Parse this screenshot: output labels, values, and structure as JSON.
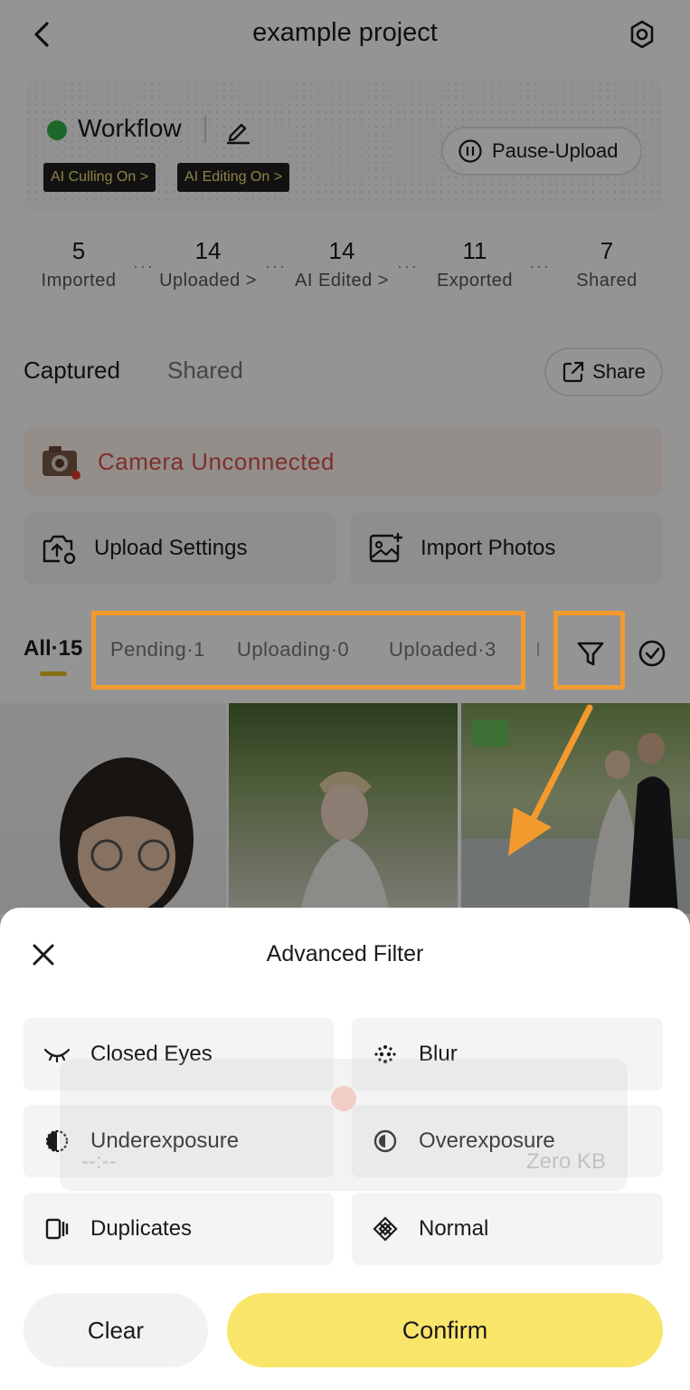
{
  "header": {
    "title": "example project"
  },
  "workflow": {
    "title": "Workflow",
    "badges": [
      "AI Culling On >",
      "AI Editing On >"
    ],
    "pause_label": "Pause-Upload",
    "stats": [
      {
        "value": "5",
        "label": "Imported"
      },
      {
        "value": "14",
        "label": "Uploaded >"
      },
      {
        "value": "14",
        "label": "AI Edited >"
      },
      {
        "value": "11",
        "label": "Exported"
      },
      {
        "value": "7",
        "label": "Shared"
      }
    ],
    "stat_separator": "···"
  },
  "tabs": {
    "captured": "Captured",
    "shared": "Shared",
    "share_button": "Share"
  },
  "camera": {
    "status": "Camera Unconnected"
  },
  "actions": {
    "upload_settings": "Upload Settings",
    "import_photos": "Import Photos"
  },
  "filters": {
    "all": "All·15",
    "pending": "Pending·1",
    "uploading": "Uploading·0",
    "uploaded": "Uploaded·3",
    "overflow": "I"
  },
  "photo_overlay": {
    "time_ghost": "--:--",
    "size_ghost": "Zero KB"
  },
  "advanced_filter": {
    "title": "Advanced Filter",
    "options": [
      {
        "label": "Closed Eyes",
        "icon": "closed-eye-icon"
      },
      {
        "label": "Blur",
        "icon": "blur-dots-icon"
      },
      {
        "label": "Underexposure",
        "icon": "underexposure-icon"
      },
      {
        "label": "Overexposure",
        "icon": "overexposure-icon"
      },
      {
        "label": "Duplicates",
        "icon": "duplicates-icon"
      },
      {
        "label": "Normal",
        "icon": "normal-icon"
      }
    ],
    "clear_label": "Clear",
    "confirm_label": "Confirm"
  },
  "colors": {
    "accent_yellow": "#fae56b",
    "highlight_orange": "#f39a2e",
    "status_green": "#34b24a",
    "warning_red": "#d8534b"
  }
}
